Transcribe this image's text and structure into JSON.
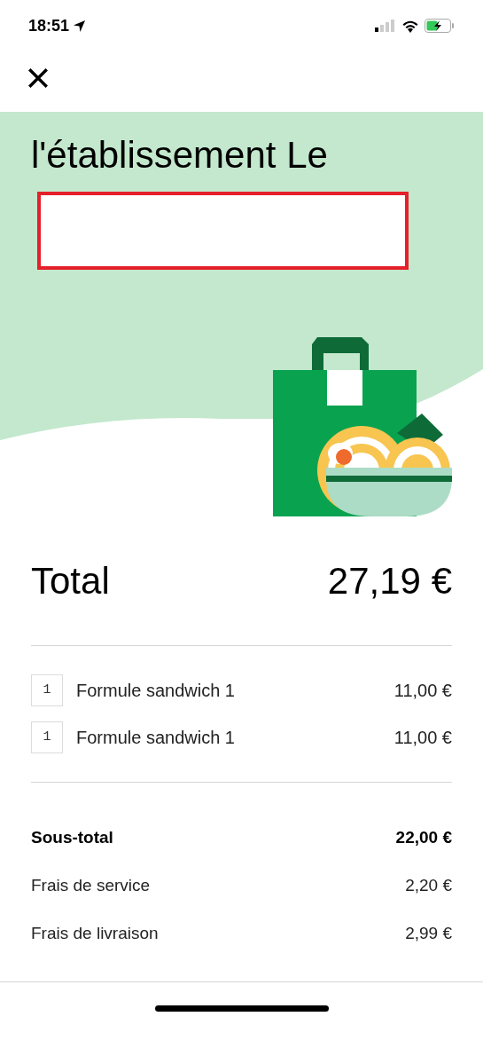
{
  "status_bar": {
    "time": "18:51"
  },
  "hero": {
    "title_lines": [
      "l'établissement Le"
    ]
  },
  "total": {
    "label": "Total",
    "amount": "27,19 €"
  },
  "items": [
    {
      "quantity": "1",
      "name": "Formule sandwich 1",
      "price": "11,00 €"
    },
    {
      "quantity": "1",
      "name": "Formule sandwich 1",
      "price": "11,00 €"
    }
  ],
  "summary": [
    {
      "label": "Sous-total",
      "amount": "22,00 €",
      "kind": "subtotal"
    },
    {
      "label": "Frais de service",
      "amount": "2,20 €",
      "kind": "fee"
    },
    {
      "label": "Frais de livraison",
      "amount": "2,99 €",
      "kind": "fee"
    }
  ]
}
